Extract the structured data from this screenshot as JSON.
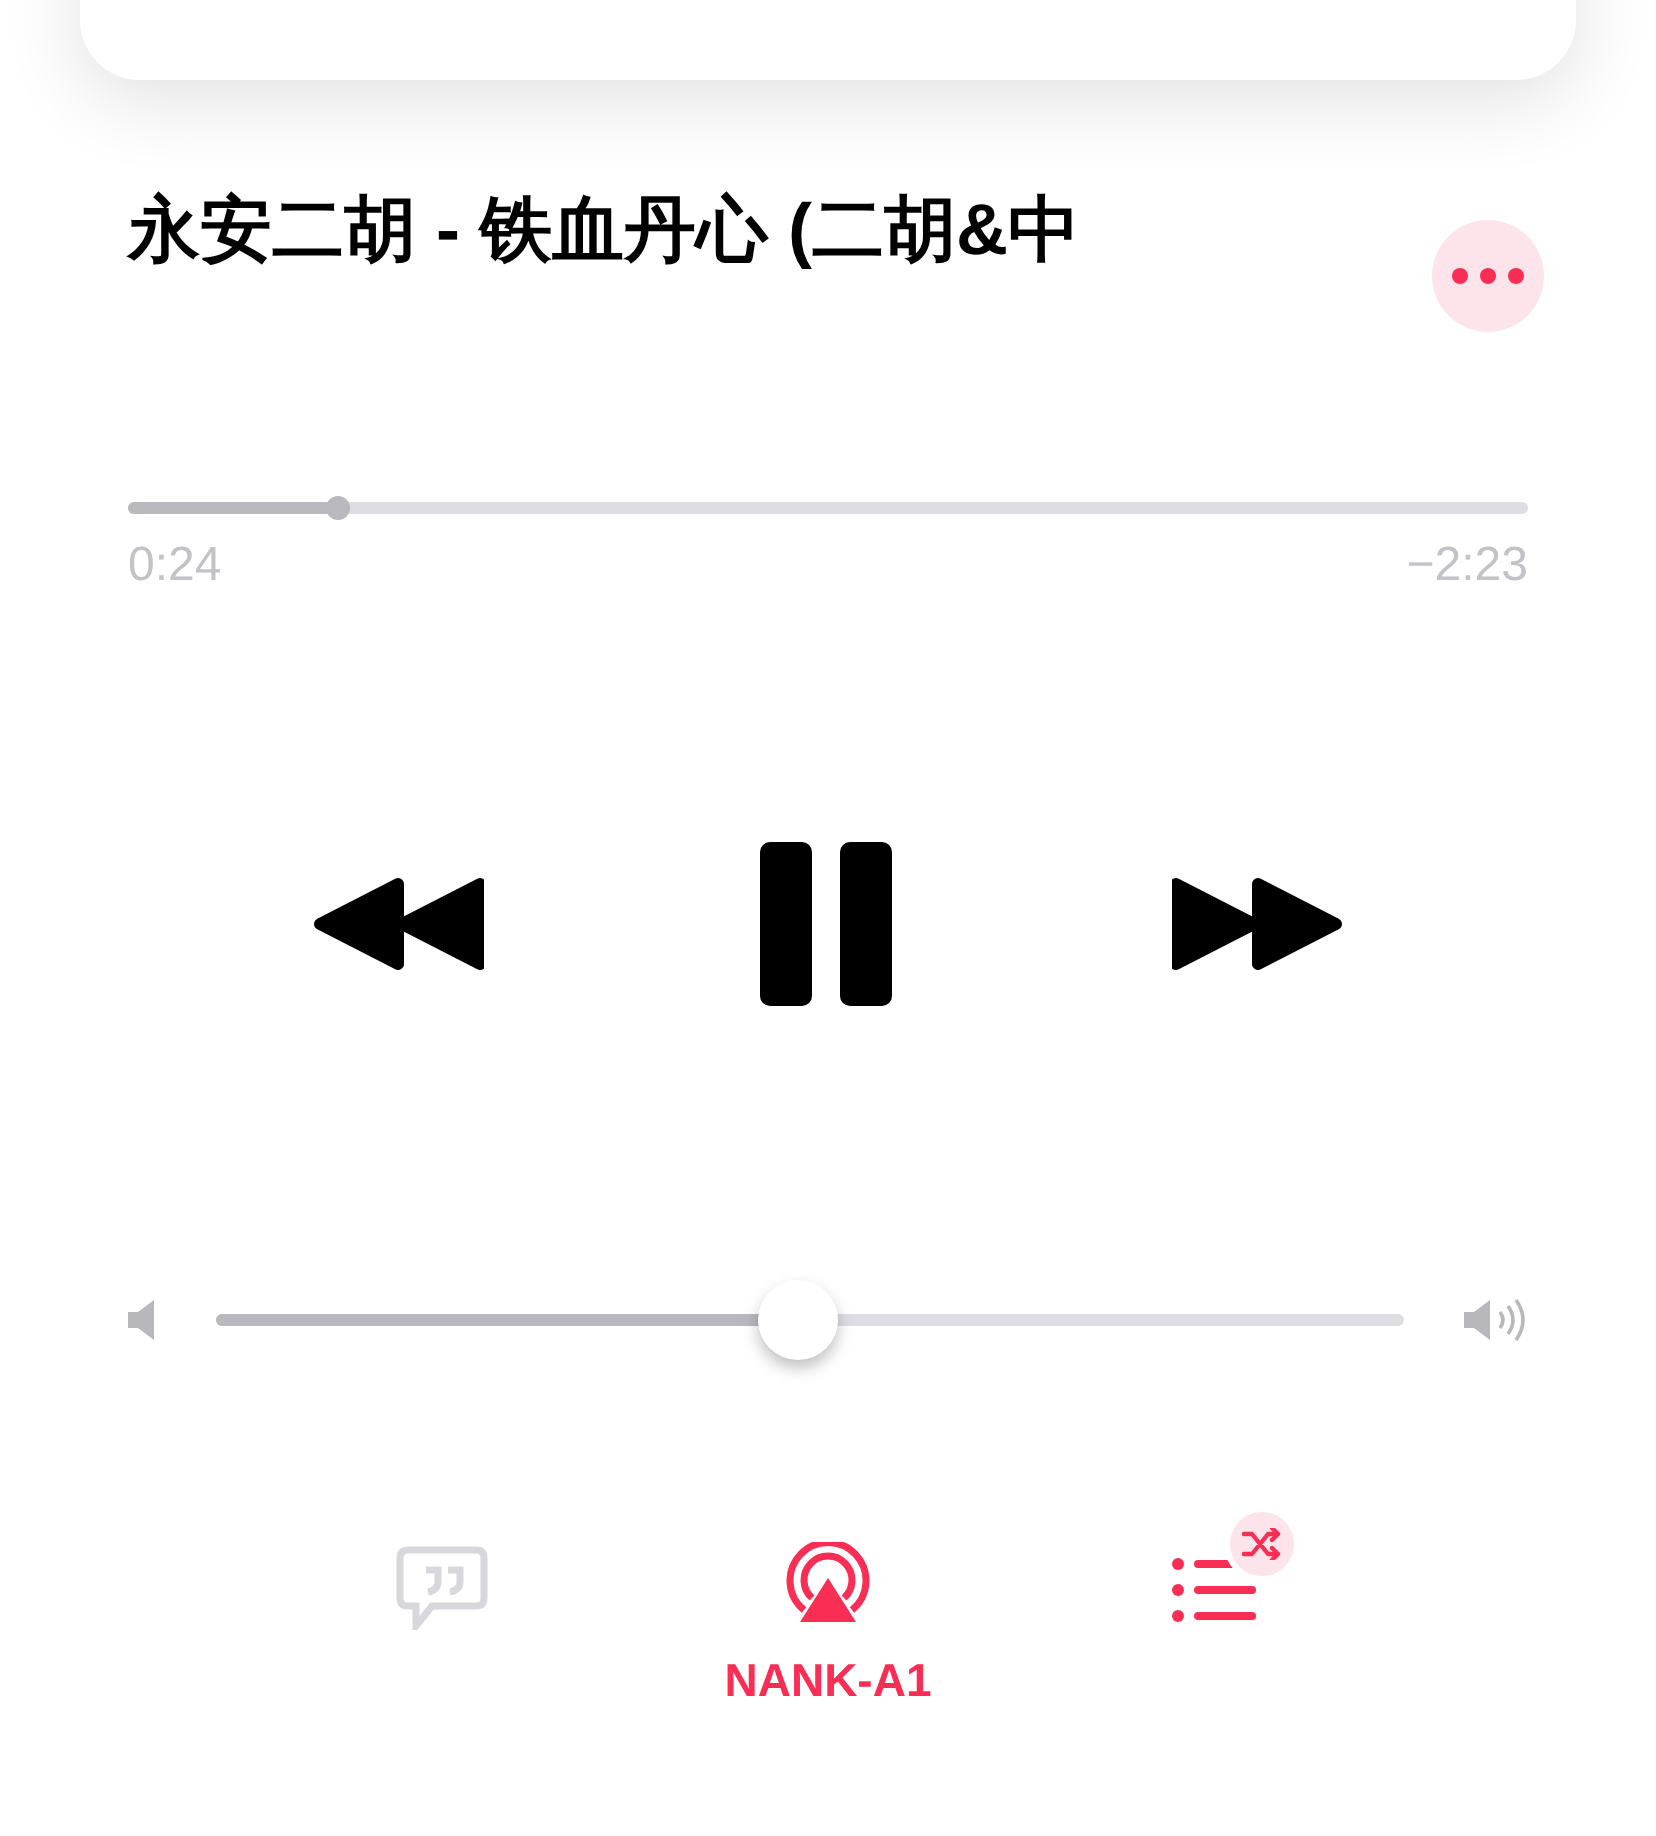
{
  "track": {
    "title": "永安二胡 - 铁血丹心 (二胡&中"
  },
  "progress": {
    "level": 0.15,
    "elapsed": "0:24",
    "remaining": "−2:23"
  },
  "transport": {
    "playing": true
  },
  "volume": {
    "level": 0.49
  },
  "bottom_bar": {
    "lyrics_active": false,
    "airplay_active": true,
    "airplay_label": "NANK-A1",
    "shuffle": true
  }
}
